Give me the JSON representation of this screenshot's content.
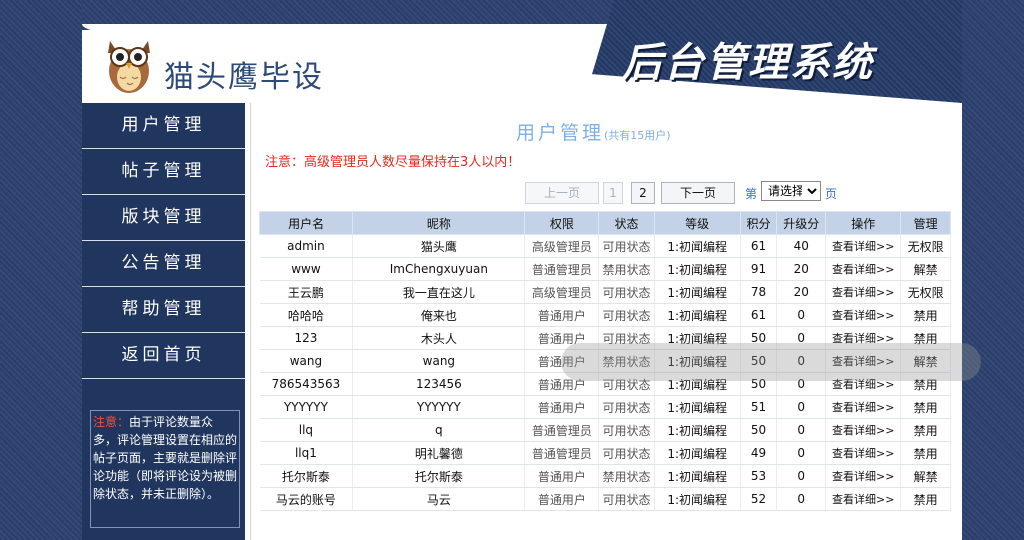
{
  "header": {
    "site_name": "猫头鹰毕设",
    "system_title": "后台管理系统"
  },
  "sidebar": {
    "items": [
      {
        "label": "用户管理"
      },
      {
        "label": "帖子管理"
      },
      {
        "label": "版块管理"
      },
      {
        "label": "公告管理"
      },
      {
        "label": "帮助管理"
      },
      {
        "label": "返回首页"
      }
    ],
    "note_label": "注意：",
    "note_text": "由于评论数量众多，评论管理设置在相应的帖子页面，主要就是删除评论功能（即将评论设为被删除状态，并未正删除）。"
  },
  "main": {
    "title": "用户管理",
    "count": "(共有15用户)",
    "warning": "注意：高级管理员人数尽量保持在3人以内！",
    "pager": {
      "prev": "上一页",
      "pages": [
        "1",
        "2"
      ],
      "next": "下一页",
      "page_prefix": "第",
      "select_value": "请选择",
      "page_suffix": "页"
    },
    "columns": [
      "用户名",
      "昵称",
      "权限",
      "状态",
      "等级",
      "积分",
      "升级分",
      "操作",
      "管理"
    ],
    "rows": [
      [
        "admin",
        "猫头鹰",
        "高级管理员",
        "可用状态",
        "1:初闻编程",
        "61",
        "40",
        "查看详细>>",
        "无权限"
      ],
      [
        "www",
        "ImChengxuyuan",
        "普通管理员",
        "禁用状态",
        "1:初闻编程",
        "91",
        "20",
        "查看详细>>",
        "解禁"
      ],
      [
        "王云鹏",
        "我一直在这儿",
        "高级管理员",
        "可用状态",
        "1:初闻编程",
        "78",
        "20",
        "查看详细>>",
        "无权限"
      ],
      [
        "哈哈哈",
        "俺来也",
        "普通用户",
        "可用状态",
        "1:初闻编程",
        "61",
        "0",
        "查看详细>>",
        "禁用"
      ],
      [
        "123",
        "木头人",
        "普通用户",
        "可用状态",
        "1:初闻编程",
        "50",
        "0",
        "查看详细>>",
        "禁用"
      ],
      [
        "wang",
        "wang",
        "普通用户",
        "禁用状态",
        "1:初闻编程",
        "50",
        "0",
        "查看详细>>",
        "解禁"
      ],
      [
        "786543563",
        "123456",
        "普通用户",
        "可用状态",
        "1:初闻编程",
        "50",
        "0",
        "查看详细>>",
        "禁用"
      ],
      [
        "YYYYYY",
        "YYYYYY",
        "普通用户",
        "可用状态",
        "1:初闻编程",
        "51",
        "0",
        "查看详细>>",
        "禁用"
      ],
      [
        "llq",
        "q",
        "普通管理员",
        "可用状态",
        "1:初闻编程",
        "50",
        "0",
        "查看详细>>",
        "禁用"
      ],
      [
        "llq1",
        "明礼馨德",
        "普通管理员",
        "可用状态",
        "1:初闻编程",
        "49",
        "0",
        "查看详细>>",
        "禁用"
      ],
      [
        "托尔斯泰",
        "托尔斯泰",
        "普通用户",
        "禁用状态",
        "1:初闻编程",
        "53",
        "0",
        "查看详细>>",
        "解禁"
      ],
      [
        "马云的账号",
        "马云",
        "普通用户",
        "可用状态",
        "1:初闻编程",
        "52",
        "0",
        "查看详细>>",
        "禁用"
      ]
    ]
  },
  "colors": {
    "navy": "#21365f",
    "accent_blue": "#2448d8",
    "warning_red": "#e8281c",
    "table_header": "#c3d2e6"
  }
}
